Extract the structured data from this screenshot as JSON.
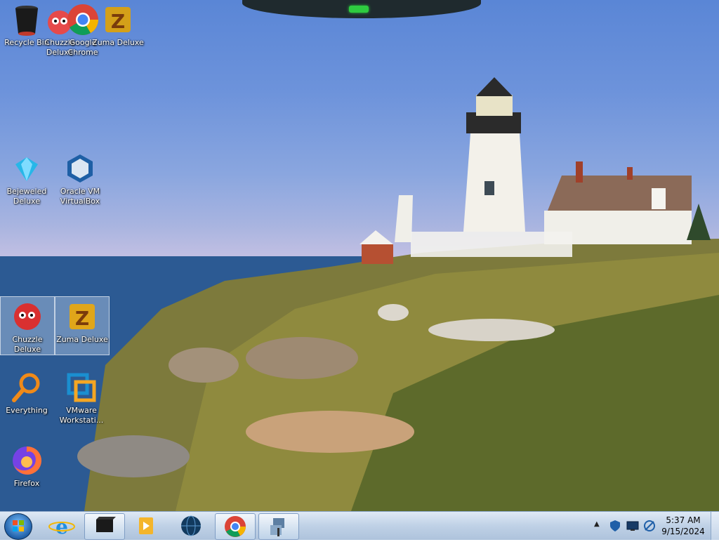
{
  "desktop": {
    "icons": [
      {
        "id": "recycle-bin",
        "label": "Recycle Bin"
      },
      {
        "id": "chuzzle-top",
        "label": "Chuzzle Deluxe"
      },
      {
        "id": "chrome",
        "label": "Google Chrome"
      },
      {
        "id": "zuma-top",
        "label": "Zuma Deluxe"
      },
      {
        "id": "bejeweled",
        "label": "Bejeweled Deluxe"
      },
      {
        "id": "virtualbox",
        "label": "Oracle VM VirtualBox"
      },
      {
        "id": "chuzzle",
        "label": "Chuzzle Deluxe"
      },
      {
        "id": "zuma",
        "label": "Zuma Deluxe"
      },
      {
        "id": "everything",
        "label": "Everything"
      },
      {
        "id": "vmware",
        "label": "VMware Workstati..."
      },
      {
        "id": "firefox",
        "label": "Firefox"
      }
    ]
  },
  "taskbar": {
    "buttons": [
      "start",
      "internet-explorer",
      "explorer-window",
      "media-player",
      "globe-app",
      "chrome",
      "network-app"
    ],
    "clock": {
      "time": "5:37 AM",
      "date": "9/15/2024"
    }
  },
  "colors": {
    "accent": "#2ecc40",
    "taskbar": "#bfd1e6"
  }
}
